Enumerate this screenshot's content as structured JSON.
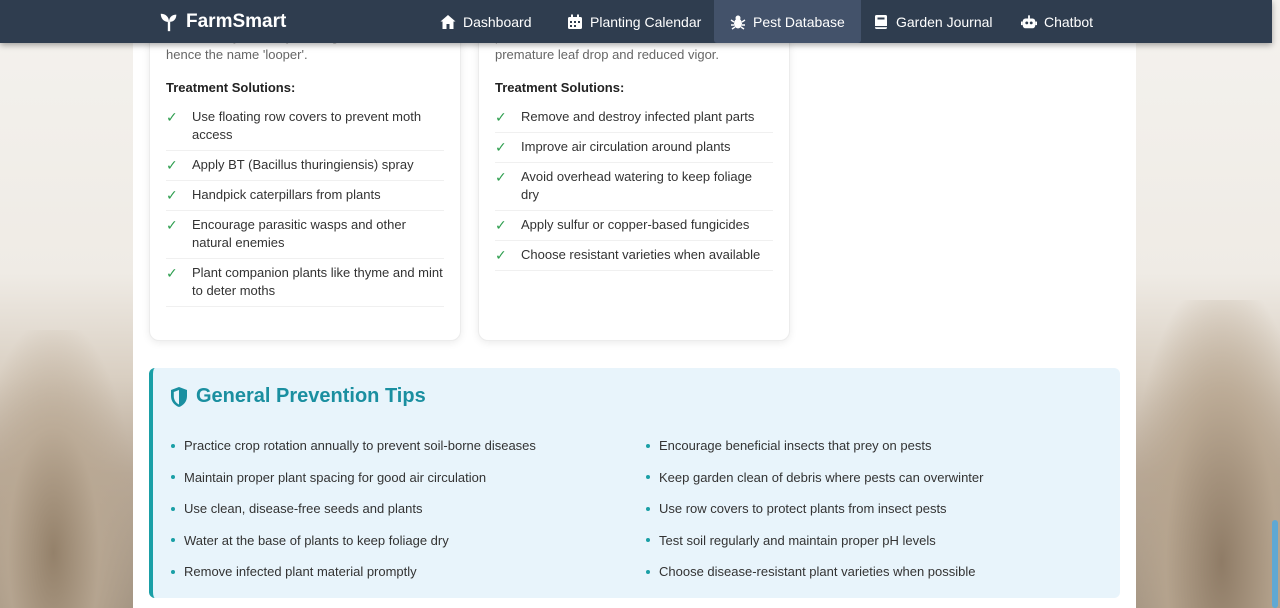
{
  "nav": {
    "brand": "FarmSmart",
    "items": [
      {
        "label": "Dashboard",
        "icon": "home-icon"
      },
      {
        "label": "Planting Calendar",
        "icon": "calendar-icon"
      },
      {
        "label": "Pest Database",
        "icon": "bug-icon",
        "active": true
      },
      {
        "label": "Garden Journal",
        "icon": "book-icon"
      },
      {
        "label": "Chatbot",
        "icon": "robot-icon"
      }
    ]
  },
  "cards": [
    {
      "intro_cut": "leaves. They move by arching their bodies,",
      "intro": "hence the name 'looper'.",
      "heading": "Treatment Solutions:",
      "solutions": [
        "Use floating row covers to prevent moth access",
        "Apply BT (Bacillus thuringiensis) spray",
        "Handpick caterpillars from plants",
        "Encourage parasitic wasps and other natural enemies",
        "Plant companion plants like thyme and mint to deter moths"
      ]
    },
    {
      "intro_cut": "pustules on leaves and stems. Can cause",
      "intro": "premature leaf drop and reduced vigor.",
      "heading": "Treatment Solutions:",
      "solutions": [
        "Remove and destroy infected plant parts",
        "Improve air circulation around plants",
        "Avoid overhead watering to keep foliage dry",
        "Apply sulfur or copper-based fungicides",
        "Choose resistant varieties when available"
      ]
    }
  ],
  "check_glyph": "✓",
  "prevention": {
    "title": "General Prevention Tips",
    "left": [
      "Practice crop rotation annually to prevent soil-borne diseases",
      "Maintain proper plant spacing for good air circulation",
      "Use clean, disease-free seeds and plants",
      "Water at the base of plants to keep foliage dry",
      "Remove infected plant material promptly"
    ],
    "right": [
      "Encourage beneficial insects that prey on pests",
      "Keep garden clean of debris where pests can overwinter",
      "Use row covers to protect plants from insect pests",
      "Test soil regularly and maintain proper pH levels",
      "Choose disease-resistant plant varieties when possible"
    ]
  },
  "colors": {
    "navbar": "#2f3d4f",
    "accent": "#1a9fa6",
    "check": "#2e9e4f",
    "prevention_bg": "#e8f4fb"
  }
}
